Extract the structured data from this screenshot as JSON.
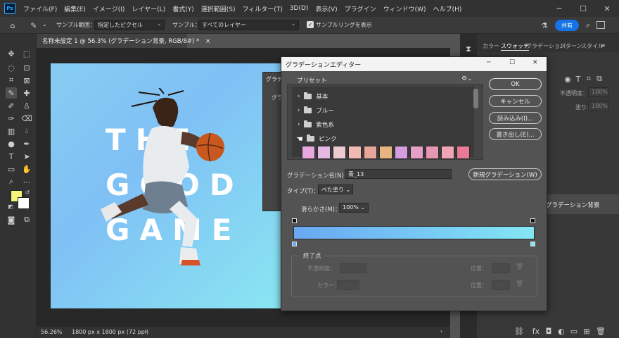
{
  "menu": {
    "logo": "Ps",
    "items": [
      "ファイル(F)",
      "編集(E)",
      "イメージ(I)",
      "レイヤー(L)",
      "書式(Y)",
      "選択範囲(S)",
      "フィルター(T)",
      "3D(D)",
      "表示(V)",
      "プラグイン",
      "ウィンドウ(W)",
      "ヘルプ(H)"
    ]
  },
  "options": {
    "sample_range_label": "サンプル範囲：",
    "sample_range_value": "指定したピクセル",
    "sample_label": "サンプル：",
    "sample_value": "すべてのレイヤー",
    "sampling_ring_label": "サンプルリングを表示",
    "share_label": "共有"
  },
  "document": {
    "tab_title": "名称未設定 1 @ 56.3% (グラデーション背景, RGB/8#) *",
    "canvas_text": [
      "THE",
      "GOOD",
      "GAME"
    ],
    "zoom": "56.26%",
    "size": "1800 px x 1800 px (72 ppi)"
  },
  "right_panel": {
    "tabs": [
      "カラー",
      "スウォッチ",
      "グラデーション",
      "パターン",
      "スタイル"
    ],
    "opacity_label": "不透明度：",
    "opacity_value": "100%",
    "fill_label": "塗り：",
    "fill_value": "100%",
    "layer_name": "グラデーション背景"
  },
  "behind_dialog": {
    "title": "グラデ",
    "text": "グラデ"
  },
  "dialog": {
    "title": "グラデーションエディター",
    "presets_label": "プリセット",
    "folders": [
      "基本",
      "ブルー",
      "紫色系",
      "ピンク"
    ],
    "pink_swatches": [
      {
        "color": "#e7a8dd"
      },
      {
        "color": "#e8b8e4"
      },
      {
        "color": "#eec8d0"
      },
      {
        "color": "#f0b9b2"
      },
      {
        "color": "#e8a59a"
      },
      {
        "color": "#e8b580"
      },
      {
        "color": "#d49de0"
      },
      {
        "color": "#e6a0c8"
      },
      {
        "color": "#e596b3"
      },
      {
        "color": "#f0a5b5"
      },
      {
        "color": "#e87a98"
      }
    ],
    "ok": "OK",
    "cancel": "キャンセル",
    "load": "読み込み(I)...",
    "save": "書き出し(E)...",
    "name_label": "グラデーション名(N)：",
    "name_value": "青_13",
    "new_gradient": "新規グラデーション(W)",
    "type_label": "タイプ(T)：",
    "type_value": "べた塗り",
    "smoothness_label": "滑らかさ(M)：",
    "smoothness_value": "100%",
    "gradient_start": "#69a8f3",
    "gradient_end": "#83e6f5",
    "stops_label": "終了点",
    "opacity_label": "不透明度：",
    "color_label": "カラー：",
    "location_label": "位置：",
    "location_label_2": "位置："
  }
}
